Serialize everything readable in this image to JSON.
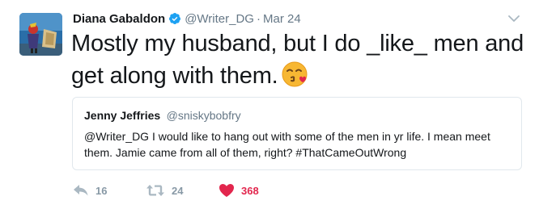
{
  "tweet": {
    "author_name": "Diana Gabaldon",
    "author_handle": "@Writer_DG",
    "separator": "·",
    "timestamp": "Mar 24",
    "text": "Mostly my husband, but I do _like_ men and get along with them.",
    "emoji": "kissing-face-blowing-heart",
    "icons": {
      "verified": "verified-badge-icon",
      "menu": "chevron-down-icon"
    }
  },
  "quoted_tweet": {
    "author_name": "Jenny Jeffries",
    "author_handle": "@sniskybobfry",
    "text": "@Writer_DG I would like to hang out with some of the men in yr life. I mean meet them. Jamie came from all of them, right? #ThatCameOutWrong"
  },
  "actions": {
    "reply_count": "16",
    "retweet_count": "24",
    "like_count": "368",
    "like_color": "#e2264d",
    "muted_color": "#8899a6",
    "verified_color": "#1da1f2"
  }
}
